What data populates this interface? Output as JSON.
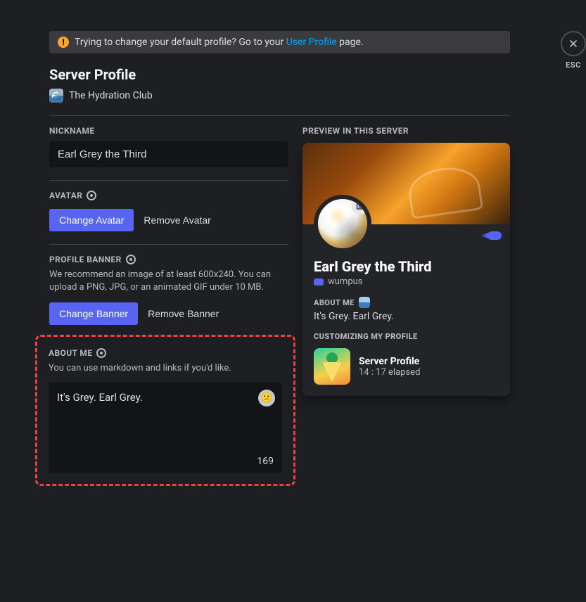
{
  "close_label": "ESC",
  "notice": {
    "pre": "Trying to change your default profile? Go to your ",
    "link": "User Profile",
    "post": " page."
  },
  "title": "Server Profile",
  "server_name": "The Hydration Club",
  "nickname": {
    "label": "NICKNAME",
    "value": "Earl Grey the Third"
  },
  "avatar": {
    "label": "AVATAR",
    "change": "Change Avatar",
    "remove": "Remove Avatar"
  },
  "banner": {
    "label": "PROFILE BANNER",
    "help": "We recommend an image of at least 600x240. You can upload a PNG, JPG, or an animated GIF under 10 MB.",
    "change": "Change Banner",
    "remove": "Remove Banner"
  },
  "about": {
    "label": "ABOUT ME",
    "help": "You can use markdown and links if you'd like.",
    "value": "It's Grey. Earl Grey.",
    "remaining": "169"
  },
  "preview": {
    "label": "PREVIEW IN THIS SERVER",
    "display_name": "Earl Grey the Third",
    "username": "wumpus",
    "about_label": "ABOUT ME",
    "about_value": "It's Grey. Earl Grey.",
    "activity_heading": "CUSTOMIZING MY PROFILE",
    "activity_title": "Server Profile",
    "activity_time": "14 : 17 elapsed"
  }
}
